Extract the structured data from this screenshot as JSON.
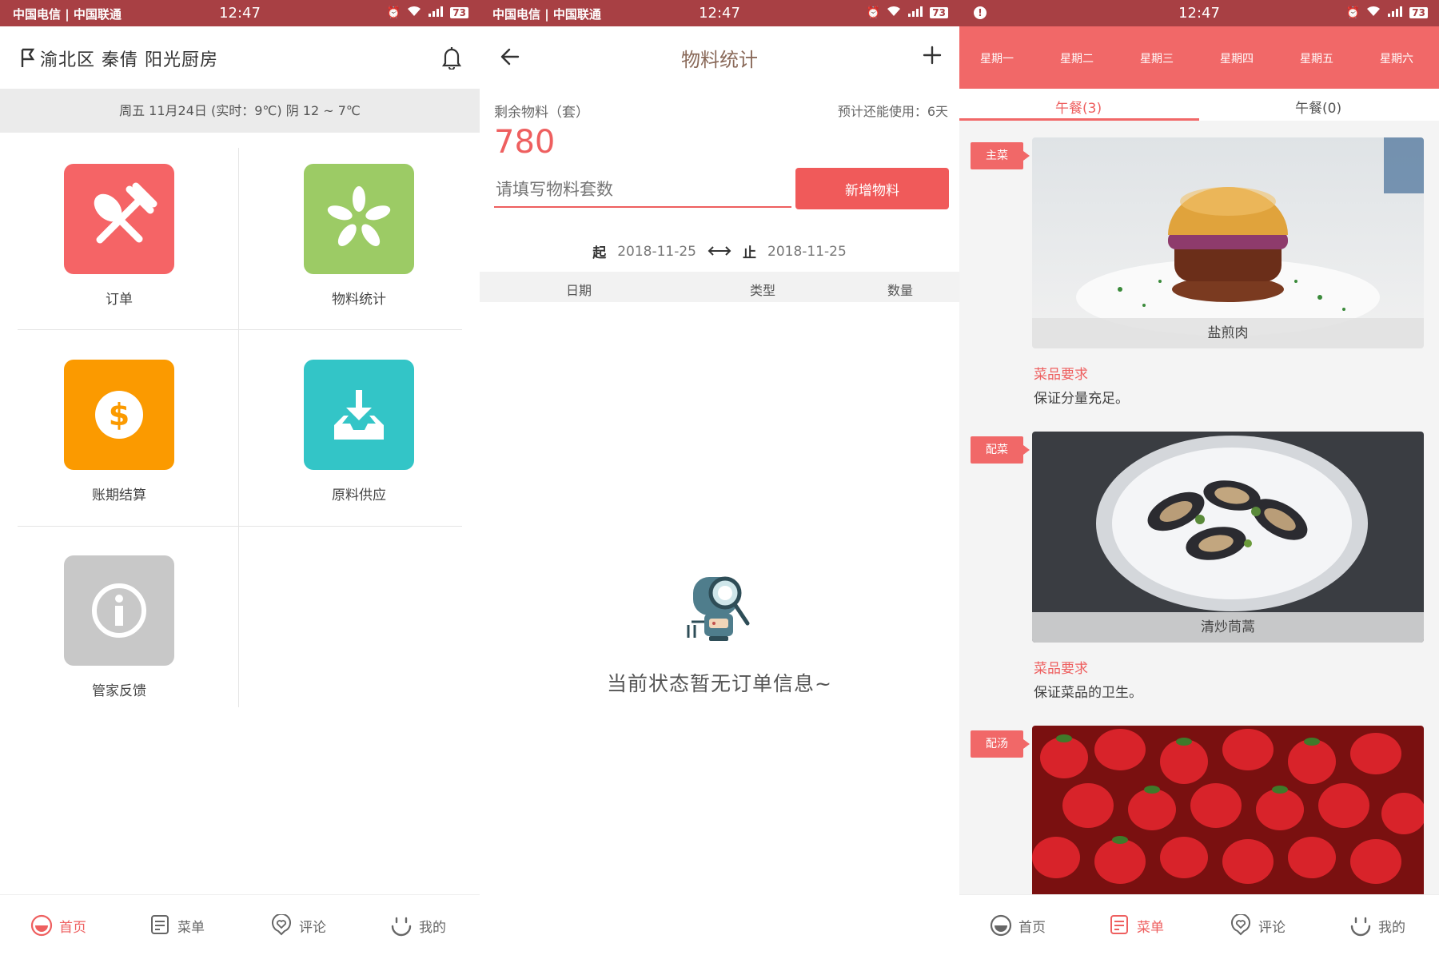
{
  "status": {
    "carrier": "中国电信 | 中国联通",
    "time": "12:47",
    "battery": "73"
  },
  "home": {
    "location": "渝北区  秦倩  阳光厨房",
    "weather": "周五 11月24日 (实时：9℃) 阴  12 ~ 7℃",
    "tiles": [
      {
        "label": "订单",
        "color": "#f56466",
        "icon": "fork-spoon-icon"
      },
      {
        "label": "物料统计",
        "color": "#9ccb65",
        "icon": "asterisk-icon"
      },
      {
        "label": "账期结算",
        "color": "#fb9a00",
        "icon": "dollar-icon"
      },
      {
        "label": "原料供应",
        "color": "#33c5c7",
        "icon": "download-tray-icon"
      },
      {
        "label": "管家反馈",
        "color": "#c8c8c8",
        "icon": "info-icon"
      }
    ]
  },
  "tabbar": {
    "home": "首页",
    "menu": "菜单",
    "comment": "评论",
    "mine": "我的"
  },
  "materials": {
    "title": "物料统计",
    "remaining_label": "剩余物料（套）",
    "remaining_value": "780",
    "forecast": "预计还能使用：6天",
    "input_placeholder": "请填写物料套数",
    "add_button": "新增物料",
    "start_label": "起",
    "start_date": "2018-11-25",
    "end_label": "止",
    "end_date": "2018-11-25",
    "columns": [
      "日期",
      "类型",
      "数量"
    ],
    "empty_message": "当前状态暂无订单信息~"
  },
  "menu": {
    "weekdays": [
      "星期一",
      "星期二",
      "星期三",
      "星期四",
      "星期五",
      "星期六"
    ],
    "meal_tabs": [
      "午餐(3)",
      "午餐(0)"
    ],
    "dishes": [
      {
        "tag": "主菜",
        "name": "盐煎肉",
        "req_label": "菜品要求",
        "req": "保证分量充足。"
      },
      {
        "tag": "配菜",
        "name": "清炒茼蒿",
        "req_label": "菜品要求",
        "req": "保证菜品的卫生。"
      },
      {
        "tag": "配汤",
        "name": "",
        "req_label": "",
        "req": ""
      }
    ]
  },
  "colors": {
    "statusbar": "#a84044",
    "accent": "#f16868"
  }
}
